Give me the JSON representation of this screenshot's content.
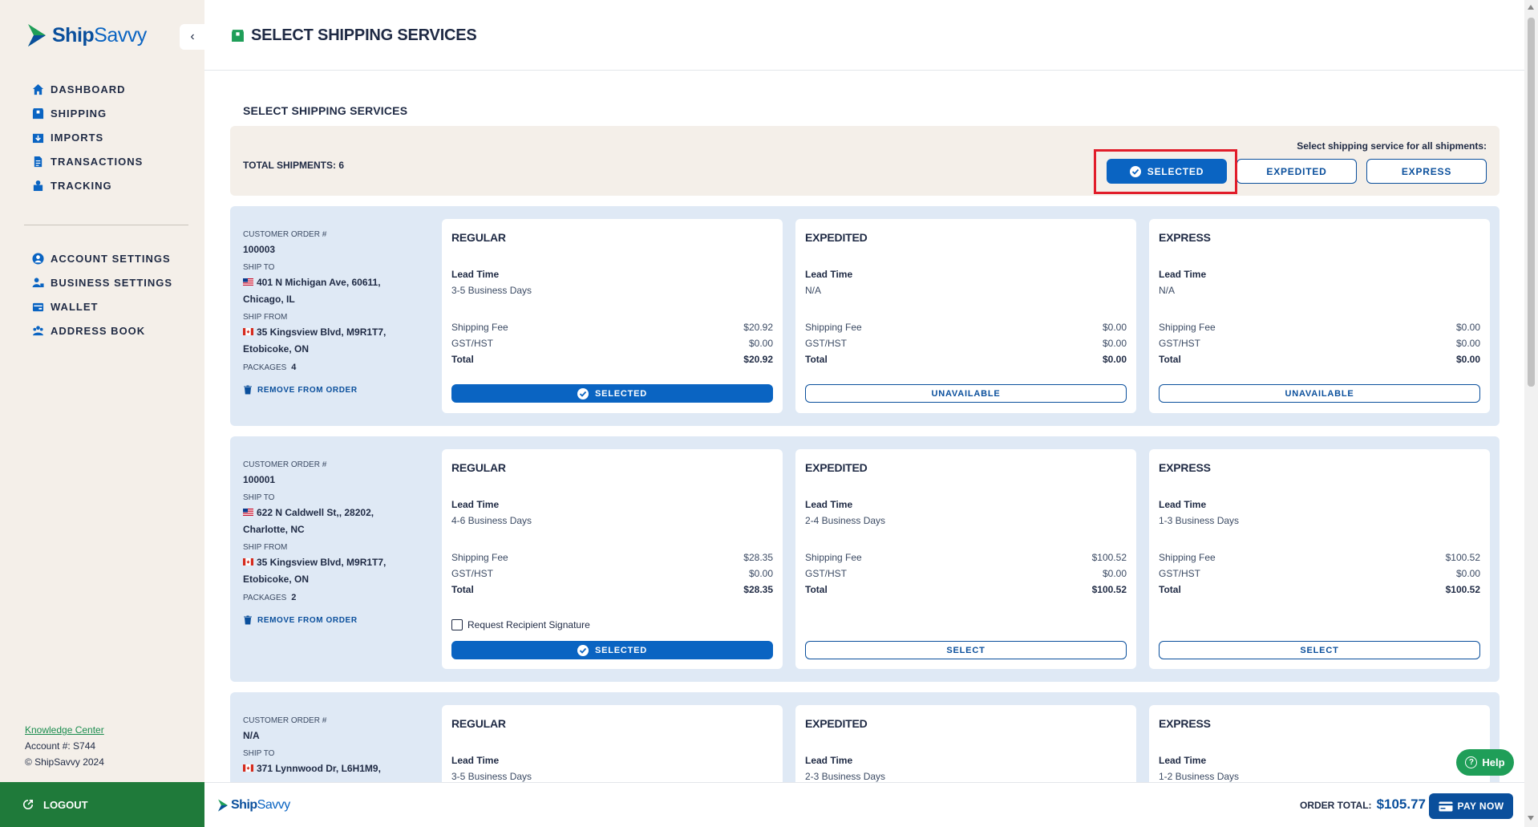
{
  "brand": {
    "logo_text_a": "Ship",
    "logo_text_b": "Savvy"
  },
  "sidebar": {
    "nav_main": [
      {
        "label": "DASHBOARD",
        "icon": "home-icon"
      },
      {
        "label": "SHIPPING",
        "icon": "box-icon"
      },
      {
        "label": "IMPORTS",
        "icon": "import-icon"
      },
      {
        "label": "TRANSACTIONS",
        "icon": "document-icon"
      },
      {
        "label": "TRACKING",
        "icon": "tracking-icon"
      }
    ],
    "nav_settings": [
      {
        "label": "ACCOUNT SETTINGS",
        "icon": "user-circle-icon"
      },
      {
        "label": "BUSINESS SETTINGS",
        "icon": "business-icon"
      },
      {
        "label": "WALLET",
        "icon": "wallet-icon"
      },
      {
        "label": "ADDRESS BOOK",
        "icon": "address-book-icon"
      }
    ],
    "knowledge_center": "Knowledge Center",
    "account": "Account #: S744",
    "copyright": "© ShipSavvy 2024",
    "logout": "LOGOUT"
  },
  "header": {
    "title": "SELECT SHIPPING SERVICES"
  },
  "main": {
    "section_title": "SELECT SHIPPING SERVICES",
    "total_shipments": "TOTAL SHIPMENTS: 6",
    "all_label": "Select shipping service for all shipments:",
    "all_buttons": {
      "selected": "SELECTED",
      "expedited": "EXPEDITED",
      "express": "EXPRESS"
    }
  },
  "labels": {
    "customer_order": "CUSTOMER ORDER #",
    "ship_to": "SHIP TO",
    "ship_from": "SHIP FROM",
    "packages": "PACKAGES",
    "remove": "REMOVE FROM ORDER",
    "lead_time": "Lead Time",
    "shipping_fee": "Shipping Fee",
    "gst": "GST/HST",
    "total": "Total",
    "signature": "Request Recipient Signature"
  },
  "shipments": [
    {
      "order": "100003",
      "ship_to_1": "401 N Michigan Ave, 60611,",
      "ship_to_2": "Chicago, IL",
      "ship_from_1": "35 Kingsview Blvd, M9R1T7,",
      "ship_from_2": "Etobicoke, ON",
      "packages": "4",
      "services": [
        {
          "name": "REGULAR",
          "lead": "3-5 Business Days",
          "fee": "$20.92",
          "gst": "$0.00",
          "total": "$20.92",
          "button": "SELECTED",
          "state": "selected"
        },
        {
          "name": "EXPEDITED",
          "lead": "N/A",
          "fee": "$0.00",
          "gst": "$0.00",
          "total": "$0.00",
          "button": "UNAVAILABLE",
          "state": "unavailable"
        },
        {
          "name": "EXPRESS",
          "lead": "N/A",
          "fee": "$0.00",
          "gst": "$0.00",
          "total": "$0.00",
          "button": "UNAVAILABLE",
          "state": "unavailable"
        }
      ]
    },
    {
      "order": "100001",
      "ship_to_1": "622 N Caldwell St,, 28202,",
      "ship_to_2": "Charlotte, NC",
      "ship_from_1": "35 Kingsview Blvd, M9R1T7,",
      "ship_from_2": "Etobicoke, ON",
      "packages": "2",
      "services": [
        {
          "name": "REGULAR",
          "lead": "4-6 Business Days",
          "fee": "$28.35",
          "gst": "$0.00",
          "total": "$28.35",
          "button": "SELECTED",
          "state": "selected"
        },
        {
          "name": "EXPEDITED",
          "lead": "2-4 Business Days",
          "fee": "$100.52",
          "gst": "$0.00",
          "total": "$100.52",
          "button": "SELECT",
          "state": "select"
        },
        {
          "name": "EXPRESS",
          "lead": "1-3 Business Days",
          "fee": "$100.52",
          "gst": "$0.00",
          "total": "$100.52",
          "button": "SELECT",
          "state": "select"
        }
      ]
    },
    {
      "order": "N/A",
      "ship_to_1": "371 Lynnwood Dr, L6H1M9,",
      "services": [
        {
          "name": "REGULAR",
          "lead": "3-5 Business Days"
        },
        {
          "name": "EXPEDITED",
          "lead": "2-3 Business Days"
        },
        {
          "name": "EXPRESS",
          "lead": "1-2 Business Days"
        }
      ]
    }
  ],
  "footer": {
    "order_total_label": "ORDER TOTAL:",
    "order_total_value": "$105.77",
    "pay_now": "PAY NOW",
    "help": "Help"
  },
  "colors": {
    "primary": "#0a64c2",
    "dark_blue": "#0a4f9c",
    "green": "#1f7a3a",
    "highlight": "#e11d2a",
    "sidebar_bg": "#f4efe9",
    "card_bg": "#dfe9f5"
  }
}
